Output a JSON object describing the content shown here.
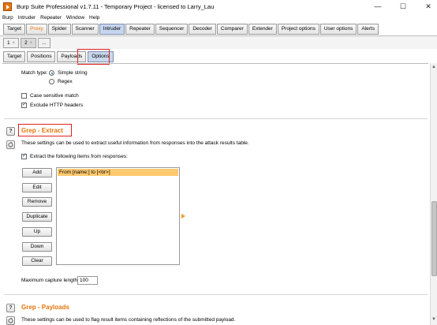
{
  "window": {
    "title": "Burp Suite Professional v1.7.11 - Temporary Project - licensed to Larry_Lau",
    "minimize": "—",
    "maximize": "☐",
    "close": "✕"
  },
  "menu": [
    "Burp",
    "Intruder",
    "Repeater",
    "Window",
    "Help"
  ],
  "main_tabs": [
    "Target",
    "Proxy",
    "Spider",
    "Scanner",
    "Intruder",
    "Repeater",
    "Sequencer",
    "Decoder",
    "Comparer",
    "Extender",
    "Project options",
    "User options",
    "Alerts"
  ],
  "number_tabs": [
    {
      "label": "1",
      "close": "×"
    },
    {
      "label": "2",
      "close": "×"
    },
    {
      "label": "...",
      "close": ""
    }
  ],
  "inner_tabs": [
    "Target",
    "Positions",
    "Payloads",
    "Options"
  ],
  "match": {
    "type_label": "Match type:",
    "simple_string": "Simple string",
    "regex": "Regex",
    "case_sensitive": "Case sensitive match",
    "exclude_headers": "Exclude HTTP headers"
  },
  "grep_extract": {
    "title": "Grep - Extract",
    "description": "These settings can be used to extract useful information from responses into the attack results table.",
    "checkbox_label": "Extract the following items from responses:",
    "buttons": [
      "Add",
      "Edit",
      "Remove",
      "Duplicate",
      "Up",
      "Down",
      "Clear"
    ],
    "items": [
      "From [name:] to [<br>]"
    ],
    "max_capture_label": "Maximum capture length:",
    "max_capture_value": "100"
  },
  "grep_payloads": {
    "title": "Grep - Payloads",
    "description": "These settings can be used to flag result items containing reflections of the submitted payload."
  },
  "scrollbar": {
    "up": "▲",
    "down": "▼"
  },
  "colors": {
    "accent": "#e8740c",
    "selected_row": "#ffc96e",
    "highlight": "#e02020"
  }
}
